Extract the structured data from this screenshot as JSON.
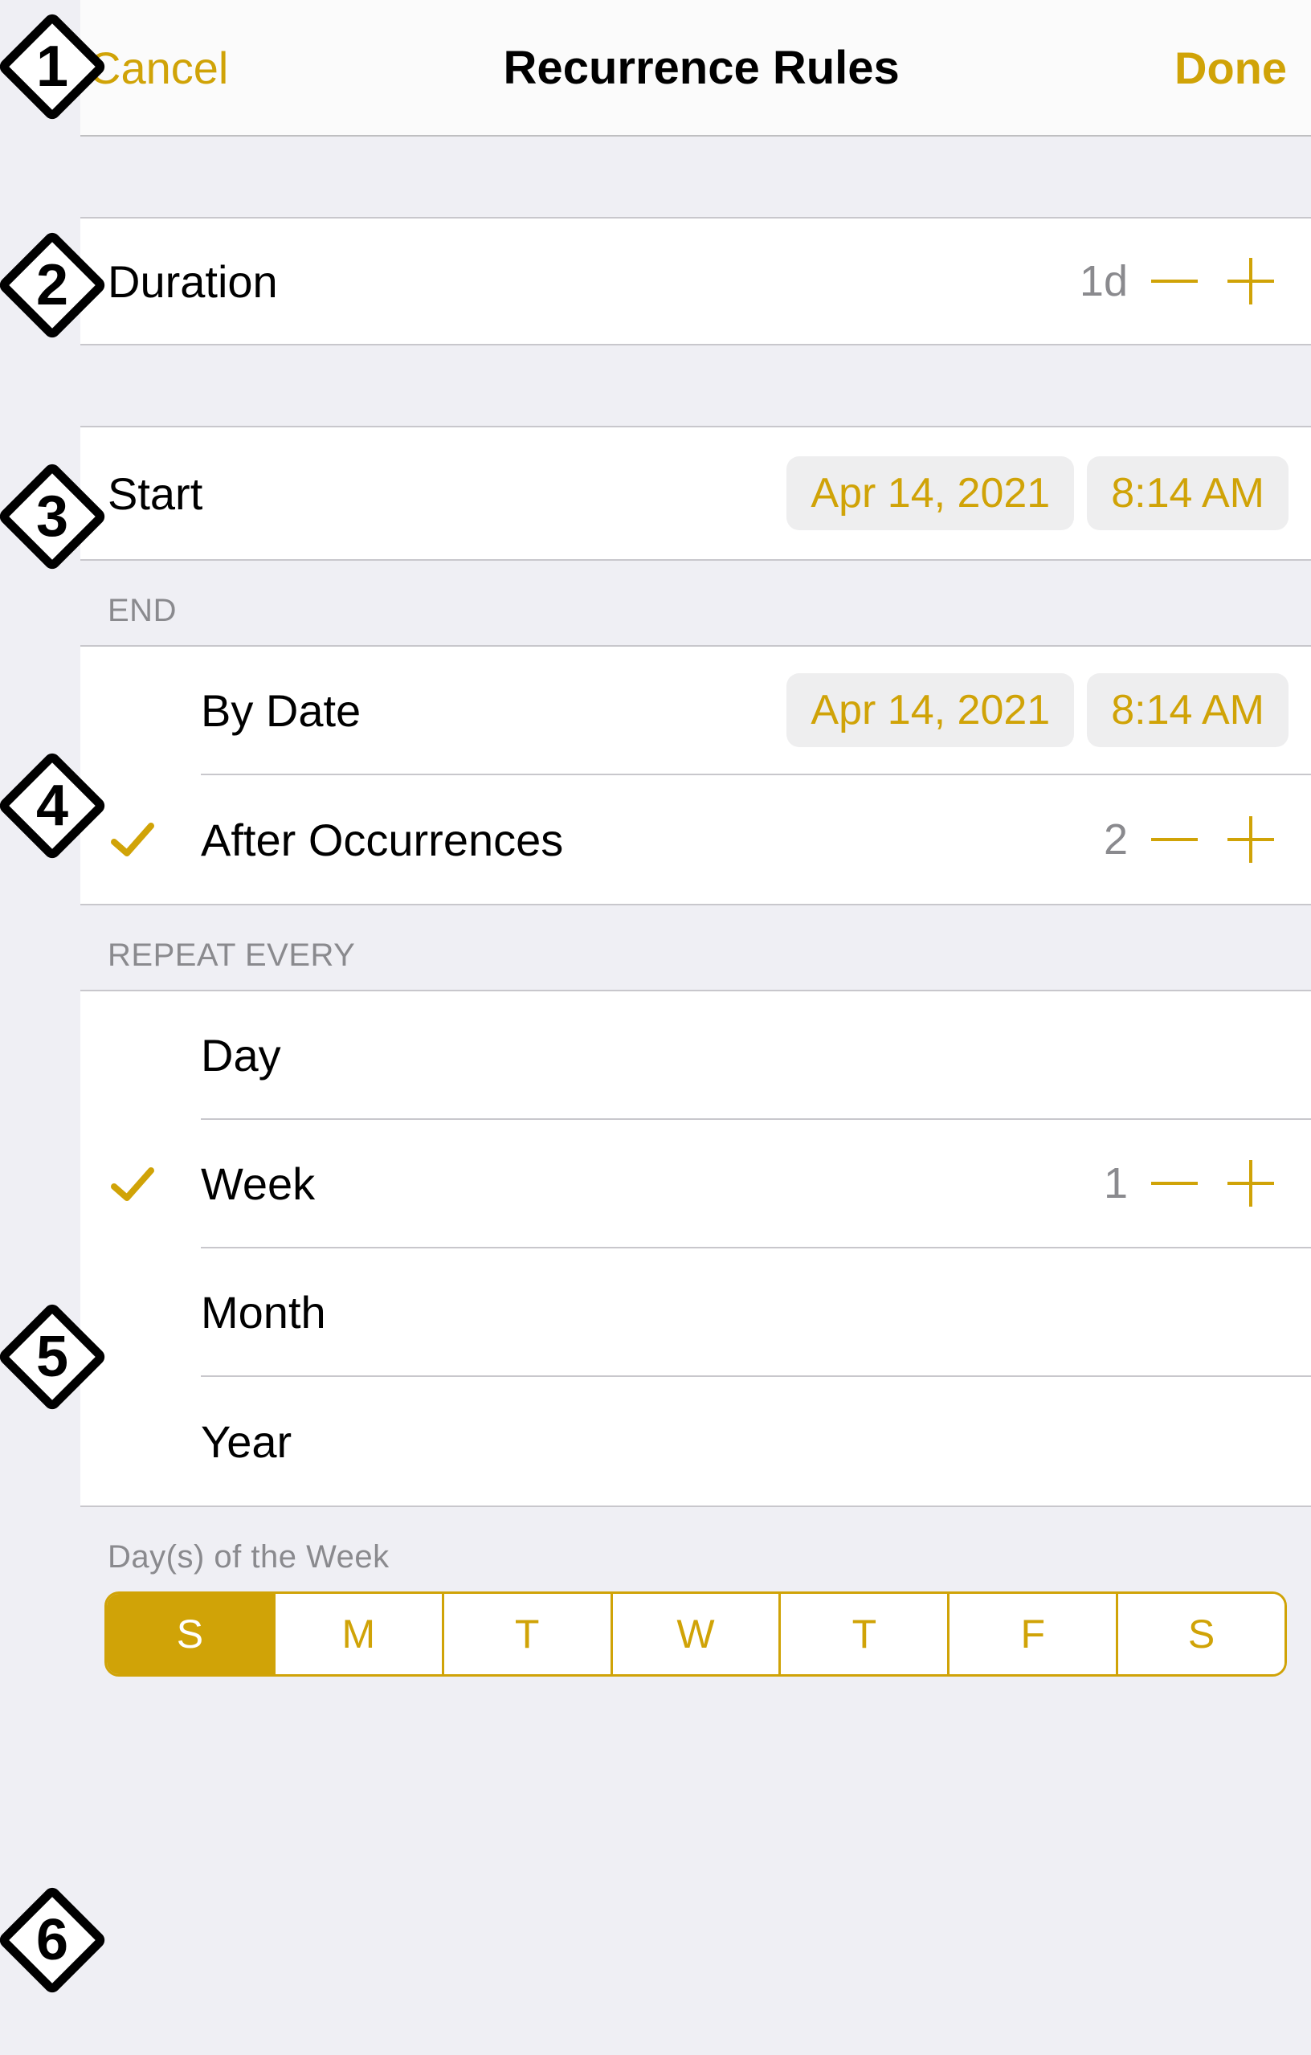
{
  "nav": {
    "cancel": "Cancel",
    "title": "Recurrence Rules",
    "done": "Done"
  },
  "duration": {
    "label": "Duration",
    "value": "1d"
  },
  "start": {
    "label": "Start",
    "date": "Apr 14, 2021",
    "time": "8:14 AM"
  },
  "end": {
    "header": "End",
    "byDate": {
      "label": "By Date",
      "date": "Apr 14, 2021",
      "time": "8:14 AM",
      "selected": false
    },
    "afterOccurrences": {
      "label": "After Occurrences",
      "value": "2",
      "selected": true
    }
  },
  "repeat": {
    "header": "Repeat Every",
    "options": [
      {
        "label": "Day",
        "selected": false
      },
      {
        "label": "Week",
        "selected": true,
        "value": "1"
      },
      {
        "label": "Month",
        "selected": false
      },
      {
        "label": "Year",
        "selected": false
      }
    ]
  },
  "daysOfWeek": {
    "header": "Day(s) of the Week",
    "days": [
      {
        "label": "S",
        "selected": true
      },
      {
        "label": "M",
        "selected": false
      },
      {
        "label": "T",
        "selected": false
      },
      {
        "label": "W",
        "selected": false
      },
      {
        "label": "T",
        "selected": false
      },
      {
        "label": "F",
        "selected": false
      },
      {
        "label": "S",
        "selected": false
      }
    ]
  },
  "markers": [
    "1",
    "2",
    "3",
    "4",
    "5",
    "6"
  ],
  "colors": {
    "accent": "#d0a307"
  }
}
